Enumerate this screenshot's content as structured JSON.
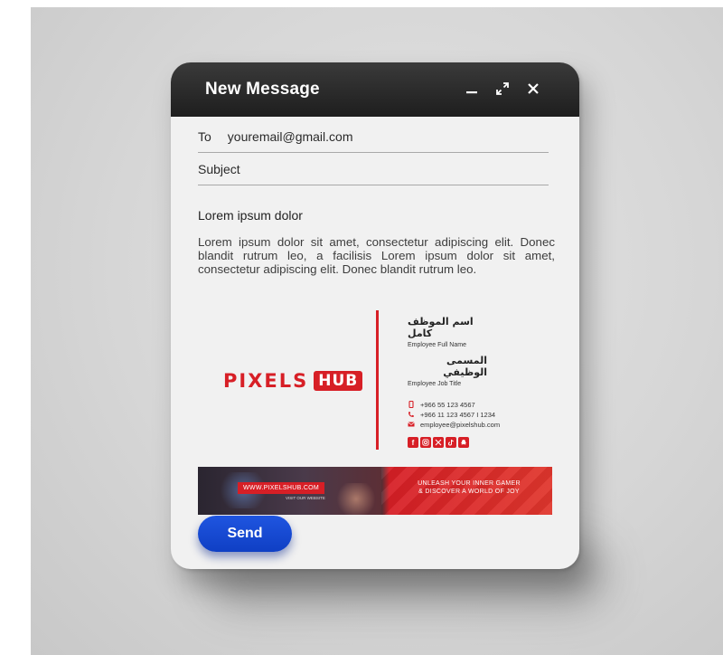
{
  "window": {
    "title": "New Message",
    "controls": {
      "minimize_icon": "minimize-icon",
      "expand_icon": "expand-icon",
      "close_icon": "close-icon"
    }
  },
  "compose": {
    "to_label": "To",
    "to_value": "youremail@gmail.com",
    "subject_label": "Subject",
    "subject_value": "",
    "body_heading": "Lorem ipsum dolor",
    "body_text": "Lorem ipsum dolor sit amet, consectetur adipiscing elit. Donec blandit rutrum leo, a facilisis Lorem ipsum dolor sit amet, consectetur adipiscing elit. Donec blandit rutrum leo."
  },
  "signature": {
    "logo_word": "PIXELS",
    "logo_box": "HUB",
    "name_ar": "اسم الموظف كامل",
    "name_en": "Employee Full Name",
    "title_ar": "المسمى الوظيفي",
    "title_en": "Employee Job Title",
    "mobile": "+966 55 123 4567",
    "phone": "+966 11 123 4567  I  1234",
    "email": "employee@pixelshub.com",
    "social_icons": [
      "facebook-icon",
      "instagram-icon",
      "x-icon",
      "tiktok-icon",
      "snapchat-icon"
    ],
    "brand_color": "#d71f26"
  },
  "banner": {
    "url": "WWW.PIXELSHUB.COM",
    "visit": "VISIT OUR WEBSITE",
    "tagline_1": "UNLEASH YOUR INNER GAMER",
    "tagline_2": "& DISCOVER A WORLD OF JOY"
  },
  "actions": {
    "send_label": "Send",
    "send_color": "#1a4bd6"
  }
}
